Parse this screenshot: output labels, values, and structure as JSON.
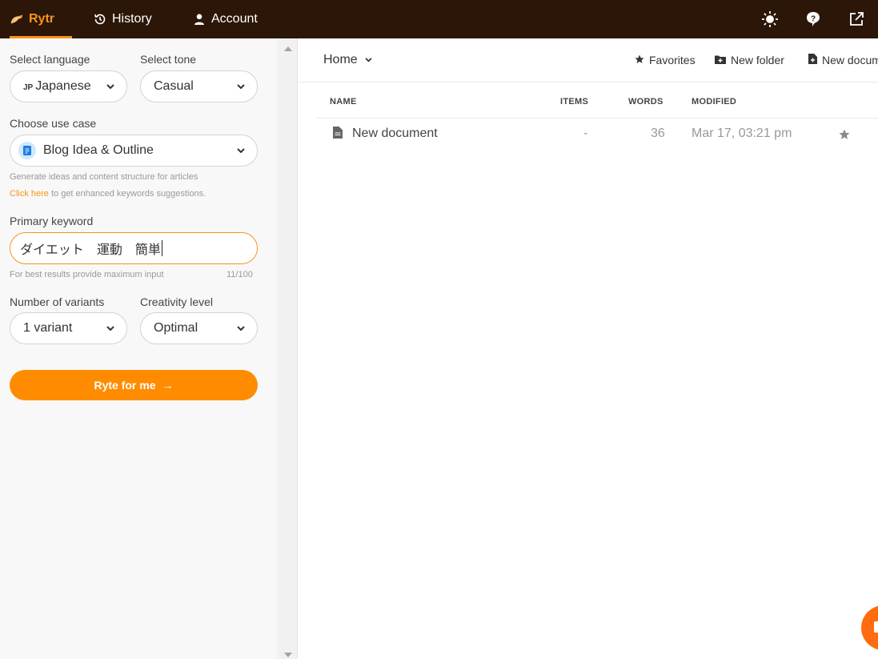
{
  "topbar": {
    "tabs": [
      {
        "label": "Rytr",
        "icon": "hand-writing-icon"
      },
      {
        "label": "History",
        "icon": "history-icon"
      },
      {
        "label": "Account",
        "icon": "user-icon"
      }
    ],
    "right_icons": [
      "sun-icon",
      "help-icon",
      "external-link-icon"
    ]
  },
  "sidebar": {
    "language_label": "Select language",
    "language_code": "JP",
    "language_value": "Japanese",
    "tone_label": "Select tone",
    "tone_value": "Casual",
    "use_case_label": "Choose use case",
    "use_case_value": "Blog Idea & Outline",
    "use_case_desc": "Generate ideas and content structure for articles",
    "click_here": "Click here",
    "keywords_hint": "to get enhanced keywords suggestions.",
    "keyword_label": "Primary keyword",
    "keyword_value": "ダイエット　運動　簡単",
    "keyword_hint": "For best results provide maximum input",
    "keyword_count": "11/100",
    "variants_label": "Number of variants",
    "variants_value": "1 variant",
    "creativity_label": "Creativity level",
    "creativity_value": "Optimal",
    "ryte_button": "Ryte for me",
    "ryte_arrow": "→"
  },
  "main": {
    "breadcrumb": "Home",
    "toolbar": {
      "favorites": "Favorites",
      "new_folder": "New folder",
      "new_document": "New document"
    },
    "table": {
      "headers": {
        "name": "NAME",
        "items": "ITEMS",
        "words": "WORDS",
        "modified": "MODIFIED"
      },
      "rows": [
        {
          "name": "New document",
          "items": "-",
          "words": "36",
          "modified": "Mar 17, 03:21 pm"
        }
      ]
    }
  },
  "colors": {
    "accent": "#f7941d",
    "button": "#ff8c00",
    "topbar": "#2c1608",
    "fab": "#ff6b0f"
  }
}
